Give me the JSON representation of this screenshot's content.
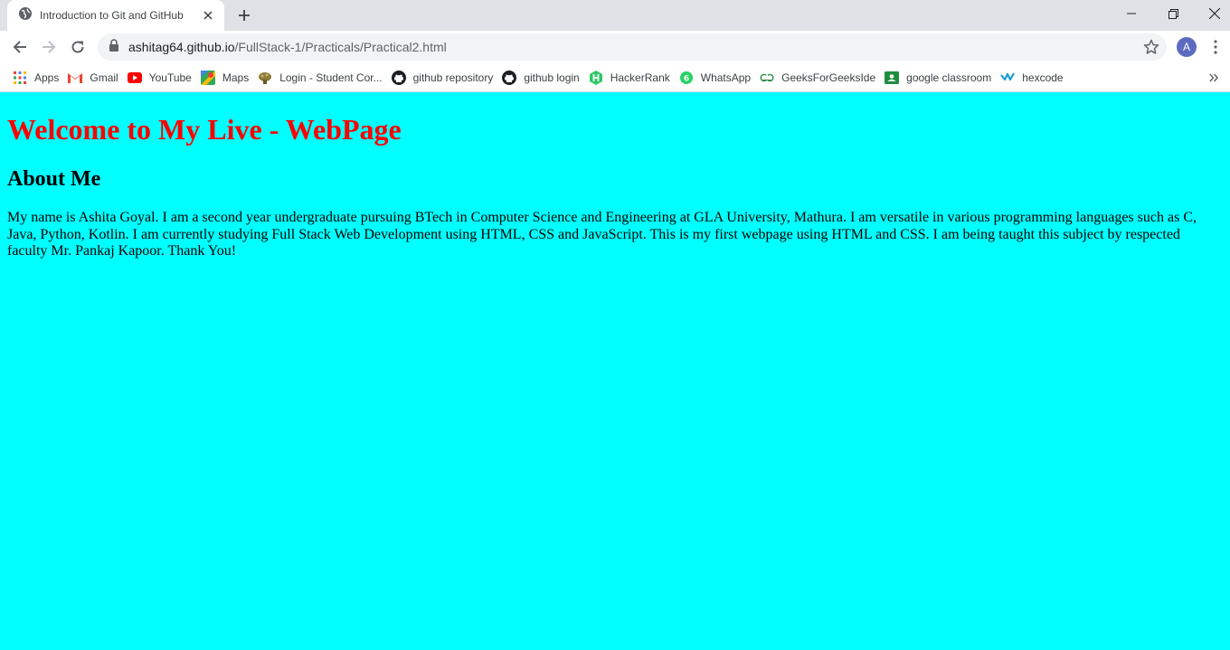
{
  "browser": {
    "tab": {
      "title": "Introduction to Git and GitHub",
      "icon": "globe-icon"
    },
    "url": {
      "host": "ashitag64.github.io",
      "path": "/FullStack-1/Practicals/Practical2.html"
    },
    "profile_initial": "A",
    "colors": {
      "tabstrip": "#dee1e6",
      "omnibox": "#f1f3f4",
      "avatar": "#5c6bc0"
    }
  },
  "bookmarks": [
    {
      "label": "Apps",
      "icon": "apps-grid-icon"
    },
    {
      "label": "Gmail",
      "icon": "gmail-icon"
    },
    {
      "label": "YouTube",
      "icon": "youtube-icon"
    },
    {
      "label": "Maps",
      "icon": "maps-icon"
    },
    {
      "label": "Login - Student Cor...",
      "icon": "student-corner-icon"
    },
    {
      "label": "github repository",
      "icon": "github-icon"
    },
    {
      "label": "github login",
      "icon": "github-icon"
    },
    {
      "label": "HackerRank",
      "icon": "hackerrank-icon"
    },
    {
      "label": "WhatsApp",
      "icon": "whatsapp-icon"
    },
    {
      "label": "GeeksForGeeksIde",
      "icon": "geeksforgeeks-icon"
    },
    {
      "label": "google classroom",
      "icon": "google-classroom-icon"
    },
    {
      "label": "hexcode",
      "icon": "hexcode-icon"
    }
  ],
  "page": {
    "background": "#00ffff",
    "heading": "Welcome to My Live - WebPage",
    "heading_color": "#ff0000",
    "subheading": "About Me",
    "paragraph": "My name is Ashita Goyal. I am a second year undergraduate pursuing BTech in Computer Science and Engineering at GLA University, Mathura. I am versatile in various programming languages such as C, Java, Python, Kotlin. I am currently studying Full Stack Web Development using HTML, CSS and JavaScript. This is my first webpage using HTML and CSS. I am being taught this subject by respected faculty Mr. Pankaj Kapoor. Thank You!"
  }
}
